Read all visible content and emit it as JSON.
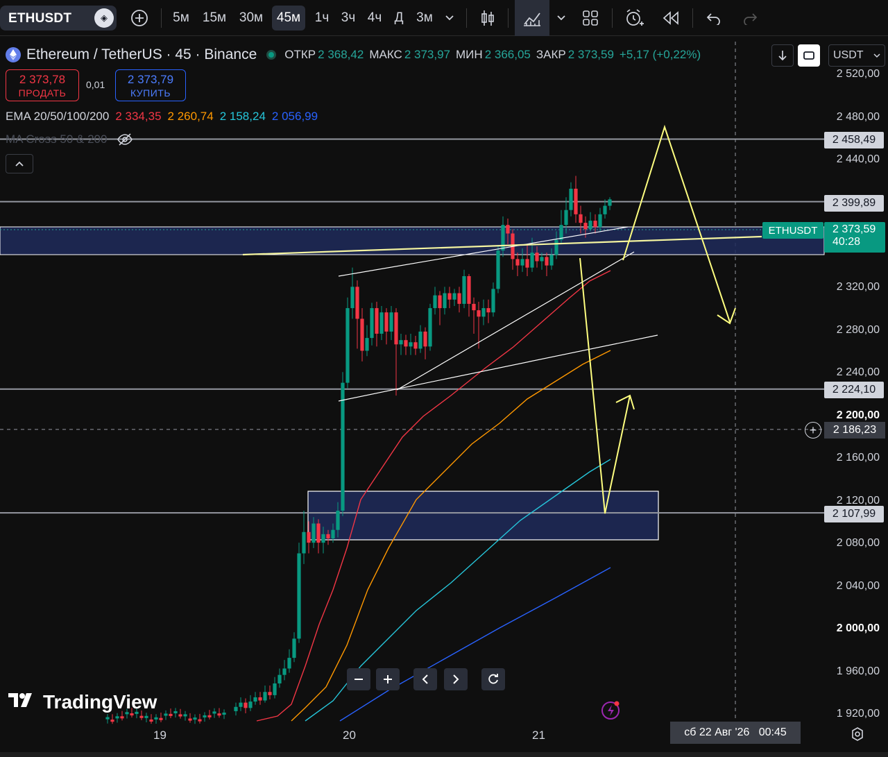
{
  "toolbar": {
    "symbol": "ETHUSDT",
    "timeframes": [
      "5м",
      "15м",
      "30м",
      "45м",
      "1ч",
      "3ч",
      "4ч",
      "Д",
      "3м"
    ],
    "active_timeframe": "45м"
  },
  "legend": {
    "title": "Ethereum / TetherUS · 45 · Binance",
    "open_label": "ОТКР",
    "open": "2 368,42",
    "high_label": "МАКС",
    "high": "2 373,97",
    "low_label": "МИН",
    "low": "2 366,05",
    "close_label": "ЗАКР",
    "close": "2 373,59",
    "change": "+5,17 (+0,22%)"
  },
  "trade": {
    "sell_price": "2 373,78",
    "sell_label": "ПРОДАТЬ",
    "spread": "0,01",
    "buy_price": "2 373,79",
    "buy_label": "КУПИТЬ"
  },
  "indicators": {
    "ema_name": "EMA 20/50/100/200",
    "ema20": "2 334,35",
    "ema50": "2 260,74",
    "ema100": "2 158,24",
    "ema200": "2 056,99",
    "macross_name": "MA Cross 50 & 200"
  },
  "currency": "USDT",
  "price_scale": {
    "labels": [
      "2 520,00",
      "2 480,00",
      "2 440,00",
      "2 320,00",
      "2 280,00",
      "2 240,00",
      "2 200,00",
      "2 160,00",
      "2 120,00",
      "2 080,00",
      "2 040,00",
      "2 000,00",
      "1 960,00",
      "1 920,00"
    ],
    "level_tags": [
      "2 458,49",
      "2 399,89",
      "2 224,10",
      "2 107,99"
    ],
    "current_symbol": "ETHUSDT",
    "current_price": "2 373,59",
    "countdown": "40:28",
    "crosshair_price": "2 186,23"
  },
  "time_scale": {
    "labels": [
      "19",
      "20",
      "21"
    ],
    "crosshair_date": "сб 22 Авг '26   00:45"
  },
  "branding": {
    "logo_text": "TradingView"
  },
  "colors": {
    "up": "#089981",
    "down": "#f23645",
    "ema20": "#f23645",
    "ema50": "#ff9800",
    "ema100": "#26c6da",
    "ema200": "#2962ff",
    "annotation": "#ffff80",
    "zone": "#1e2a5a"
  }
}
